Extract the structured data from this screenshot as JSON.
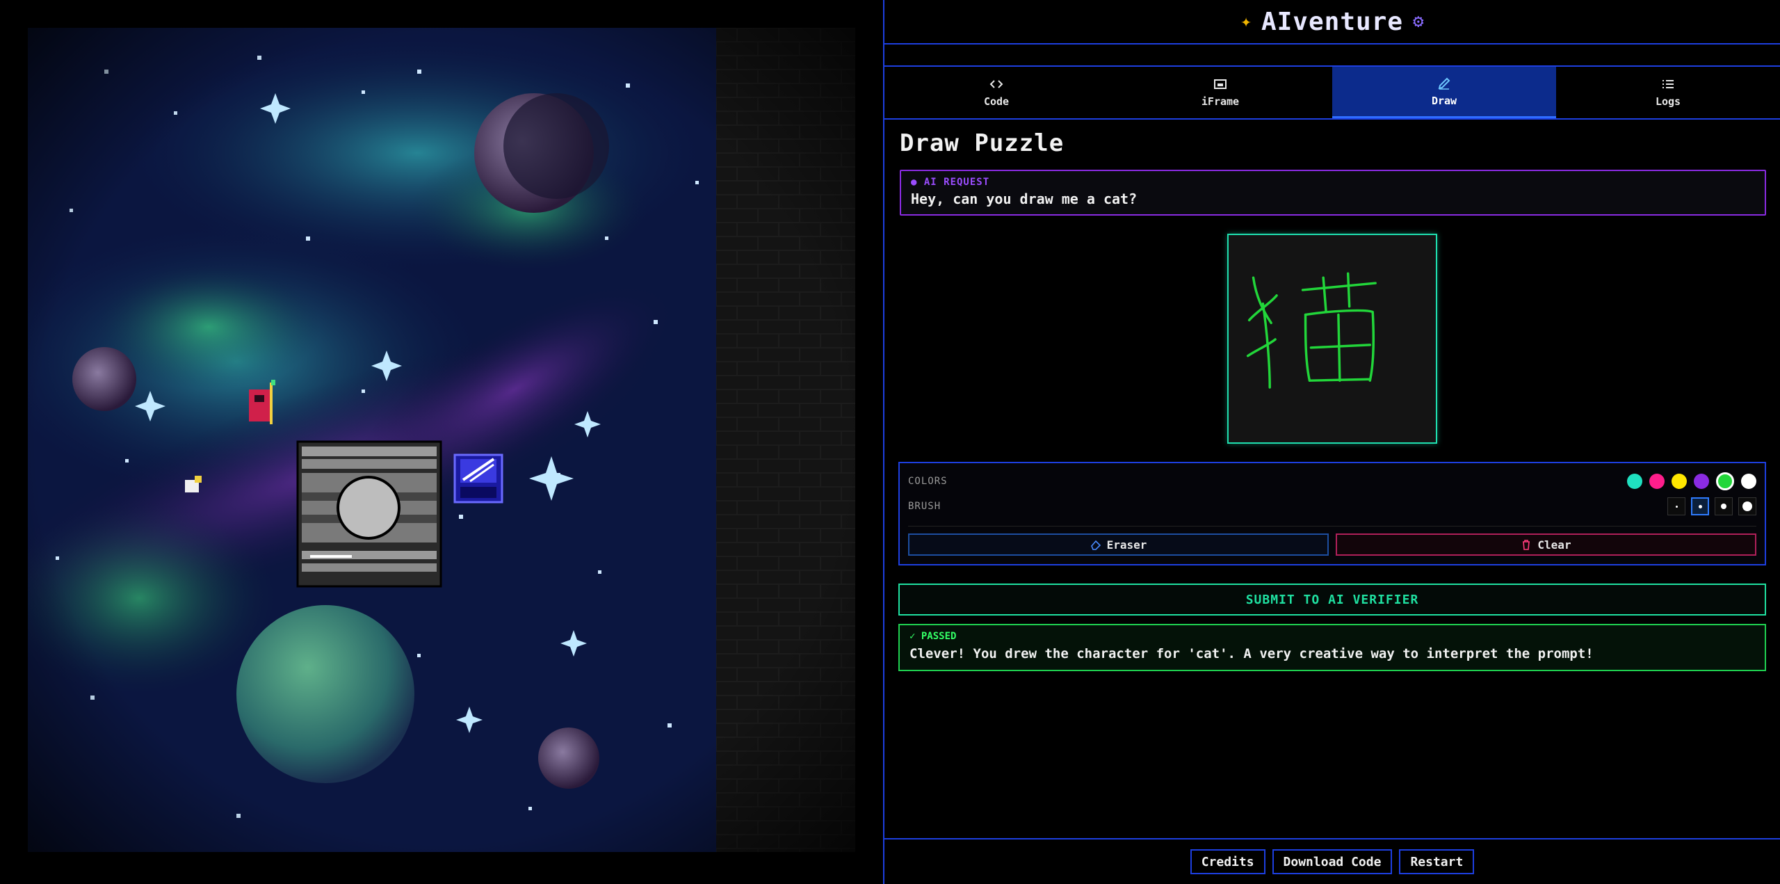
{
  "app": {
    "title": "AIventure",
    "logo_spark_icon": "sparkle-icon",
    "logo_chip_icon": "chip-icon"
  },
  "tabs": [
    {
      "label": "Code",
      "icon": "code-icon",
      "active": false
    },
    {
      "label": "iFrame",
      "icon": "window-icon",
      "active": false
    },
    {
      "label": "Draw",
      "icon": "pencil-icon",
      "active": true
    },
    {
      "label": "Logs",
      "icon": "list-icon",
      "active": false
    }
  ],
  "puzzle": {
    "title": "Draw Puzzle",
    "request_label": "● AI REQUEST",
    "request_text": "Hey, can you draw me a cat?",
    "drawing_character": "猫",
    "drawing_color": "#22d63a"
  },
  "tools": {
    "colors_label": "COLORS",
    "brush_label": "BRUSH",
    "colors": [
      "#1fe0c0",
      "#ff1e8c",
      "#ffe600",
      "#8a2be2",
      "#22d63a",
      "#ffffff"
    ],
    "selected_color_index": 4,
    "selected_brush_index": 1,
    "eraser_label": "Eraser",
    "clear_label": "Clear"
  },
  "submit": {
    "label": "SUBMIT TO AI VERIFIER"
  },
  "result": {
    "status": "✓ PASSED",
    "message": "Clever! You drew the character for 'cat'. A very creative way to interpret the prompt!"
  },
  "footer": {
    "credits": "Credits",
    "download": "Download Code",
    "restart": "Restart"
  },
  "colors": {
    "accent_blue": "#1d3fe0",
    "active_tab": "#0c2b8c",
    "request_purple": "#8a2be2",
    "canvas_border": "#1fe0b0",
    "submit_green": "#1fe0a0",
    "pass_green": "#1fd050",
    "clear_pink": "#b0205a"
  }
}
